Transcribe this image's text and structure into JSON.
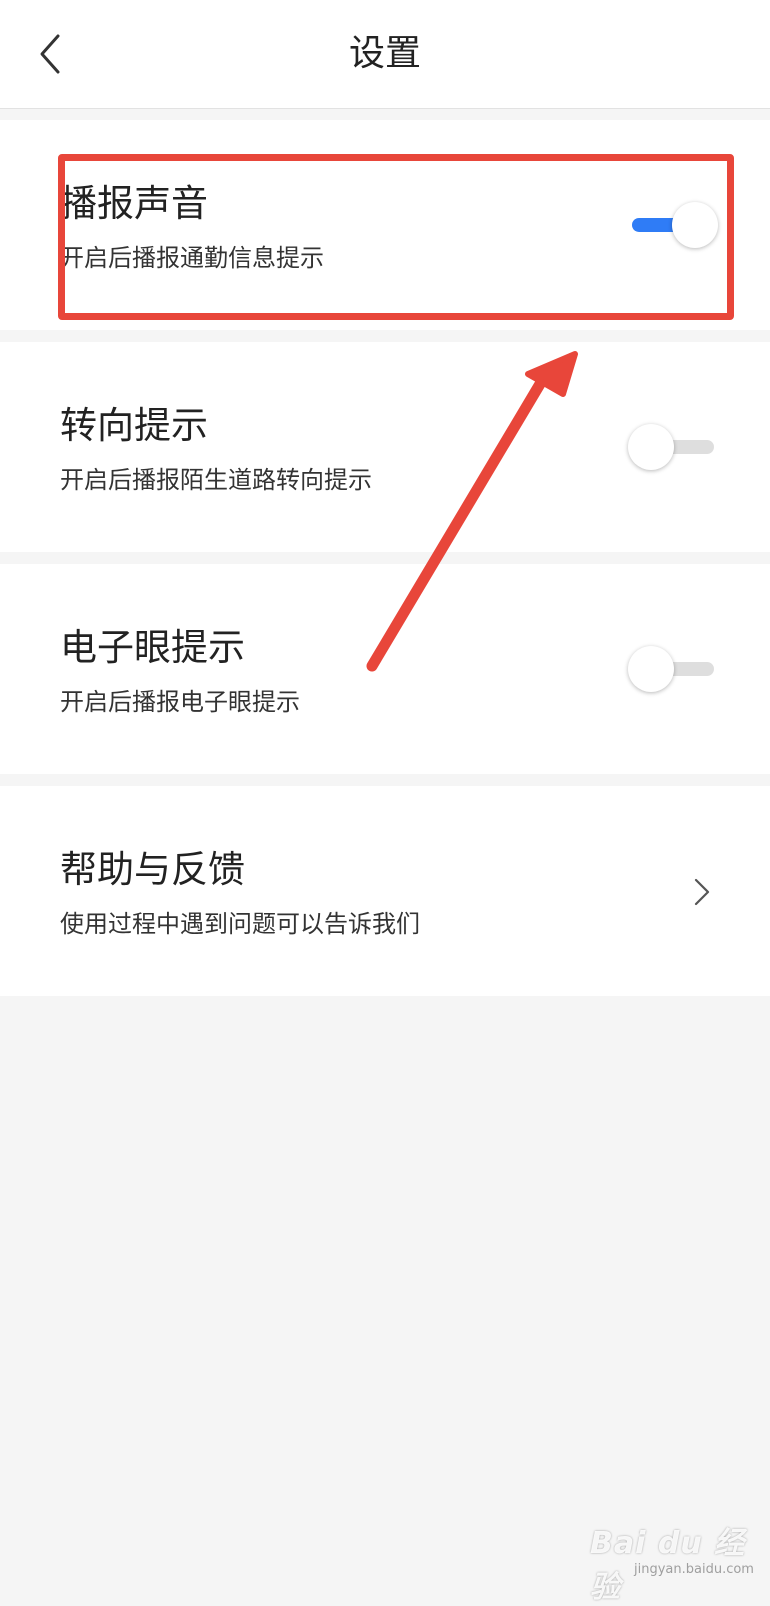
{
  "header": {
    "title": "设置",
    "back_icon": "chevron-left-icon"
  },
  "settings": [
    {
      "title": "播报声音",
      "subtitle": "开启后播报通勤信息提示",
      "control": "toggle",
      "enabled": true
    },
    {
      "title": "转向提示",
      "subtitle": "开启后播报陌生道路转向提示",
      "control": "toggle",
      "enabled": false
    },
    {
      "title": "电子眼提示",
      "subtitle": "开启后播报电子眼提示",
      "control": "toggle",
      "enabled": false
    },
    {
      "title": "帮助与反馈",
      "subtitle": "使用过程中遇到问题可以告诉我们",
      "control": "chevron",
      "icon": "chevron-right-icon"
    }
  ],
  "annotation": {
    "highlight_color": "#e8463a",
    "arrow_color": "#e8463a"
  },
  "colors": {
    "toggle_on": "#2f7cf6",
    "toggle_off": "#dedede",
    "background": "#f5f5f5"
  },
  "watermark": {
    "logo": "Bai du 经验",
    "url": "jingyan.baidu.com"
  }
}
